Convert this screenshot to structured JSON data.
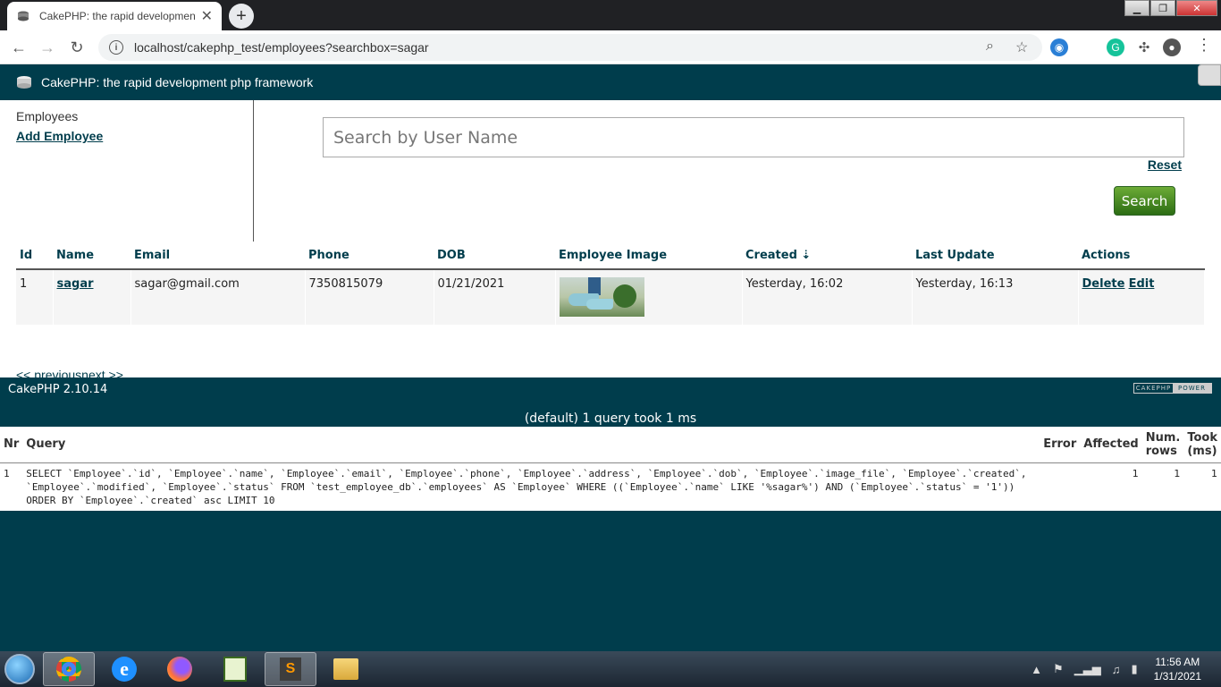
{
  "browser": {
    "tab_title": "CakePHP: the rapid development",
    "url": "localhost/cakephp_test/employees?searchbox=sagar",
    "new_tab_symbol": "+",
    "close_symbol": "✕"
  },
  "app": {
    "header_title": "CakePHP: the rapid development php framework"
  },
  "sidebar": {
    "heading": "Employees",
    "add_link": "Add Employee"
  },
  "search": {
    "placeholder": "Search by User Name",
    "reset_label": "Reset",
    "button_label": "Search"
  },
  "table": {
    "headers": [
      "Id",
      "Name",
      "Email",
      "Phone",
      "DOB",
      "Employee Image",
      "Created ⇣",
      "Last Update",
      "Actions"
    ],
    "rows": [
      {
        "id": "1",
        "name": "sagar",
        "email": "sagar@gmail.com",
        "phone": "7350815079",
        "dob": "01/21/2021",
        "created": "Yesterday, 16:02",
        "last_update": "Yesterday, 16:13",
        "delete_label": "Delete",
        "edit_label": "Edit"
      }
    ]
  },
  "paging": {
    "prev": "<< previous",
    "next": "next >>"
  },
  "footer": {
    "version": "CakePHP 2.10.14",
    "power_left": "CAKEPHP",
    "power_right": "POWER"
  },
  "sql_log": {
    "caption": "(default) 1 query took 1 ms",
    "headers": [
      "Nr",
      "Query",
      "Error",
      "Affected",
      "Num. rows",
      "Took (ms)"
    ],
    "rows": [
      {
        "nr": "1",
        "query": "SELECT `Employee`.`id`, `Employee`.`name`, `Employee`.`email`, `Employee`.`phone`, `Employee`.`address`, `Employee`.`dob`, `Employee`.`image_file`, `Employee`.`created`, `Employee`.`modified`, `Employee`.`status` FROM `test_employee_db`.`employees` AS `Employee` WHERE ((`Employee`.`name` LIKE '%sagar%') AND (`Employee`.`status` = '1')) ORDER BY `Employee`.`created` asc LIMIT 10",
        "error": "",
        "affected": "1",
        "num_rows": "1",
        "took": "1"
      }
    ]
  },
  "taskbar": {
    "time": "11:56 AM",
    "date": "1/31/2021",
    "sublime_letter": "S"
  },
  "colors": {
    "brand": "#003d4c",
    "search_button": "#4c8f26"
  }
}
